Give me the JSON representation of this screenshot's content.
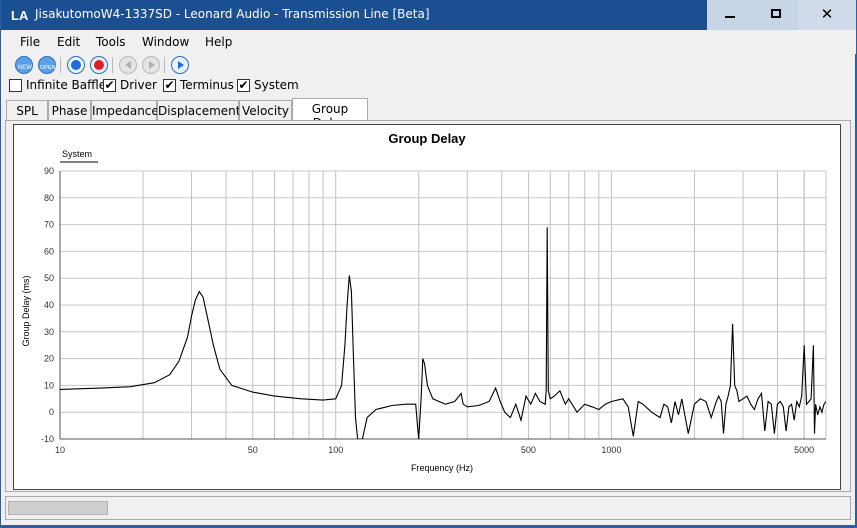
{
  "window": {
    "title": "JisakutomoW4-1337SD - Leonard Audio - Transmission Line [Beta]",
    "icon_text": "LA",
    "controls": {
      "minimize": "minimize-icon",
      "maximize": "maximize-icon",
      "close": "✕"
    }
  },
  "menubar": {
    "items": [
      "File",
      "Edit",
      "Tools",
      "Window",
      "Help"
    ]
  },
  "toolbar": {
    "buttons": [
      {
        "icon": "new-icon",
        "label": "NEW"
      },
      {
        "icon": "open-icon",
        "label": "OPEN"
      },
      {
        "icon": "record-blue-icon"
      },
      {
        "icon": "record-red-icon"
      },
      {
        "icon": "step-back-icon"
      },
      {
        "icon": "step-forward-icon"
      },
      {
        "icon": "play-icon"
      }
    ]
  },
  "options": {
    "checkboxes": [
      {
        "label": "Infinite Baffle",
        "checked": false
      },
      {
        "label": "Driver",
        "checked": true
      },
      {
        "label": "Terminus",
        "checked": true
      },
      {
        "label": "System",
        "checked": true
      }
    ]
  },
  "tabs": {
    "items": [
      "SPL",
      "Phase",
      "Impedance",
      "Displacement",
      "Velocity",
      "Group Delay"
    ],
    "active": "Group Delay"
  },
  "chart_data": {
    "type": "line",
    "title": "Group Delay",
    "xlabel": "Frequency (Hz)",
    "ylabel": "Group Delay (ms)",
    "x_scale": "log",
    "xlim": [
      10,
      6000
    ],
    "ylim": [
      -10,
      90
    ],
    "x_ticks": [
      10,
      50,
      100,
      500,
      1000,
      5000
    ],
    "y_ticks": [
      -10,
      0,
      10,
      20,
      30,
      40,
      50,
      60,
      70,
      80,
      90
    ],
    "grid": true,
    "legend": "top-left",
    "series": [
      {
        "name": "System",
        "color": "#000000",
        "points": [
          [
            10,
            8.5
          ],
          [
            14,
            9.0
          ],
          [
            18,
            9.5
          ],
          [
            22,
            11
          ],
          [
            25,
            14
          ],
          [
            27,
            19
          ],
          [
            29,
            28
          ],
          [
            30,
            36
          ],
          [
            31,
            42
          ],
          [
            32,
            45
          ],
          [
            33,
            43
          ],
          [
            34,
            37
          ],
          [
            36,
            25
          ],
          [
            38,
            16
          ],
          [
            42,
            10
          ],
          [
            50,
            7.5
          ],
          [
            60,
            6
          ],
          [
            75,
            5
          ],
          [
            90,
            4.5
          ],
          [
            100,
            5
          ],
          [
            105,
            10
          ],
          [
            108,
            25
          ],
          [
            110,
            40
          ],
          [
            112,
            51
          ],
          [
            114,
            45
          ],
          [
            116,
            20
          ],
          [
            118,
            -2
          ],
          [
            120,
            -10
          ],
          [
            125,
            -10
          ],
          [
            130,
            -2
          ],
          [
            140,
            1
          ],
          [
            160,
            2.5
          ],
          [
            180,
            3
          ],
          [
            195,
            3
          ],
          [
            198,
            -5
          ],
          [
            200,
            -10
          ],
          [
            204,
            5
          ],
          [
            207,
            20
          ],
          [
            210,
            18
          ],
          [
            215,
            10
          ],
          [
            225,
            5
          ],
          [
            250,
            3
          ],
          [
            270,
            4
          ],
          [
            285,
            7
          ],
          [
            290,
            3
          ],
          [
            300,
            2
          ],
          [
            330,
            2.5
          ],
          [
            360,
            4
          ],
          [
            380,
            9
          ],
          [
            395,
            4
          ],
          [
            410,
            0
          ],
          [
            430,
            -2
          ],
          [
            450,
            3
          ],
          [
            470,
            -3
          ],
          [
            490,
            6
          ],
          [
            510,
            3
          ],
          [
            530,
            7
          ],
          [
            550,
            4
          ],
          [
            575,
            3
          ],
          [
            580,
            8
          ],
          [
            585,
            69
          ],
          [
            590,
            8
          ],
          [
            600,
            5
          ],
          [
            620,
            6
          ],
          [
            650,
            8
          ],
          [
            680,
            3
          ],
          [
            700,
            5
          ],
          [
            750,
            0
          ],
          [
            800,
            3
          ],
          [
            850,
            2
          ],
          [
            900,
            1
          ],
          [
            950,
            3
          ],
          [
            1000,
            4
          ],
          [
            1100,
            5
          ],
          [
            1150,
            2
          ],
          [
            1200,
            -9
          ],
          [
            1250,
            4
          ],
          [
            1300,
            3
          ],
          [
            1400,
            0
          ],
          [
            1500,
            -2
          ],
          [
            1550,
            3
          ],
          [
            1600,
            2
          ],
          [
            1650,
            -4
          ],
          [
            1700,
            4
          ],
          [
            1750,
            -1
          ],
          [
            1800,
            5
          ],
          [
            1900,
            -8
          ],
          [
            2000,
            3
          ],
          [
            2100,
            5
          ],
          [
            2200,
            4
          ],
          [
            2300,
            -2
          ],
          [
            2400,
            4
          ],
          [
            2450,
            6
          ],
          [
            2500,
            4
          ],
          [
            2550,
            -8
          ],
          [
            2600,
            3
          ],
          [
            2650,
            6
          ],
          [
            2700,
            10
          ],
          [
            2750,
            33
          ],
          [
            2800,
            10
          ],
          [
            2850,
            8
          ],
          [
            2900,
            4
          ],
          [
            3000,
            5
          ],
          [
            3100,
            6
          ],
          [
            3200,
            3
          ],
          [
            3300,
            1
          ],
          [
            3400,
            5
          ],
          [
            3500,
            7
          ],
          [
            3600,
            -7
          ],
          [
            3700,
            4
          ],
          [
            3800,
            3
          ],
          [
            3900,
            -8
          ],
          [
            4000,
            3
          ],
          [
            4100,
            4
          ],
          [
            4200,
            2
          ],
          [
            4300,
            -7
          ],
          [
            4400,
            2
          ],
          [
            4500,
            3
          ],
          [
            4600,
            -3
          ],
          [
            4700,
            4
          ],
          [
            4800,
            2
          ],
          [
            4900,
            6
          ],
          [
            5000,
            25
          ],
          [
            5100,
            3
          ],
          [
            5200,
            4
          ],
          [
            5300,
            5
          ],
          [
            5400,
            25
          ],
          [
            5450,
            -8
          ],
          [
            5500,
            3
          ],
          [
            5600,
            -1
          ],
          [
            5700,
            2
          ],
          [
            5800,
            0
          ],
          [
            5900,
            3
          ],
          [
            6000,
            4
          ]
        ]
      }
    ]
  }
}
